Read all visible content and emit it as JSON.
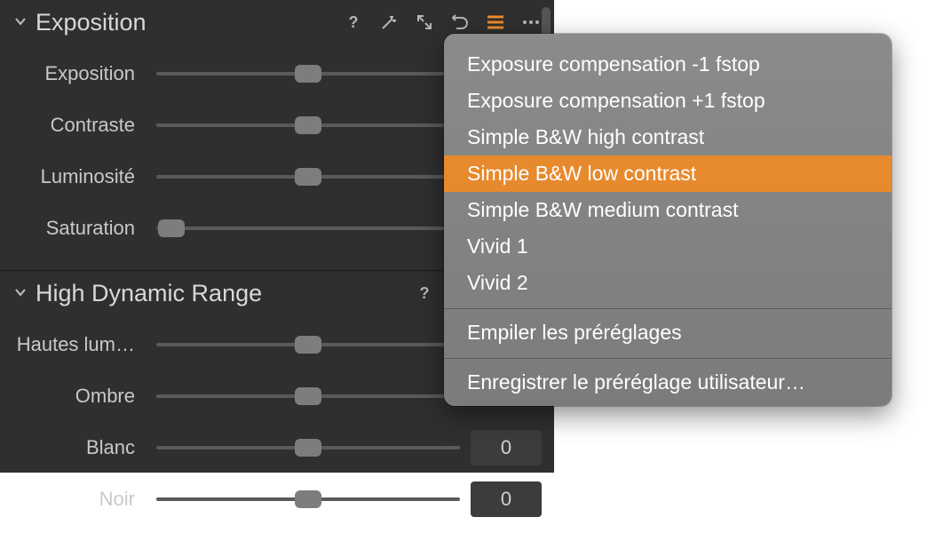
{
  "panel": {
    "groups": [
      {
        "title": "Exposition",
        "sliders": [
          {
            "label": "Exposition",
            "pos": 50,
            "value": null
          },
          {
            "label": "Contraste",
            "pos": 50,
            "value": null
          },
          {
            "label": "Luminosité",
            "pos": 50,
            "value": null
          },
          {
            "label": "Saturation",
            "pos": 5,
            "value": null
          }
        ]
      },
      {
        "title": "High Dynamic Range",
        "sliders": [
          {
            "label": "Hautes lum…",
            "pos": 50,
            "value": null
          },
          {
            "label": "Ombre",
            "pos": 50,
            "value": null
          },
          {
            "label": "Blanc",
            "pos": 50,
            "value": "0"
          },
          {
            "label": "Noir",
            "pos": 50,
            "value": "0"
          }
        ]
      }
    ]
  },
  "popup": {
    "presets": [
      "Exposure compensation -1 fstop",
      "Exposure compensation +1 fstop",
      "Simple B&W high contrast",
      "Simple B&W low contrast",
      "Simple B&W medium contrast",
      "Vivid 1",
      "Vivid 2"
    ],
    "selected_index": 3,
    "stack_label": "Empiler les préréglages",
    "save_label": "Enregistrer le préréglage utilisateur…"
  },
  "colors": {
    "accent": "#e78a2e"
  },
  "icons": {
    "help": "help-icon",
    "wand": "wand-icon",
    "expand": "expand-icon",
    "undo": "undo-icon",
    "presets": "presets-icon",
    "more": "more-icon",
    "chevron": "chevron-down-icon"
  }
}
